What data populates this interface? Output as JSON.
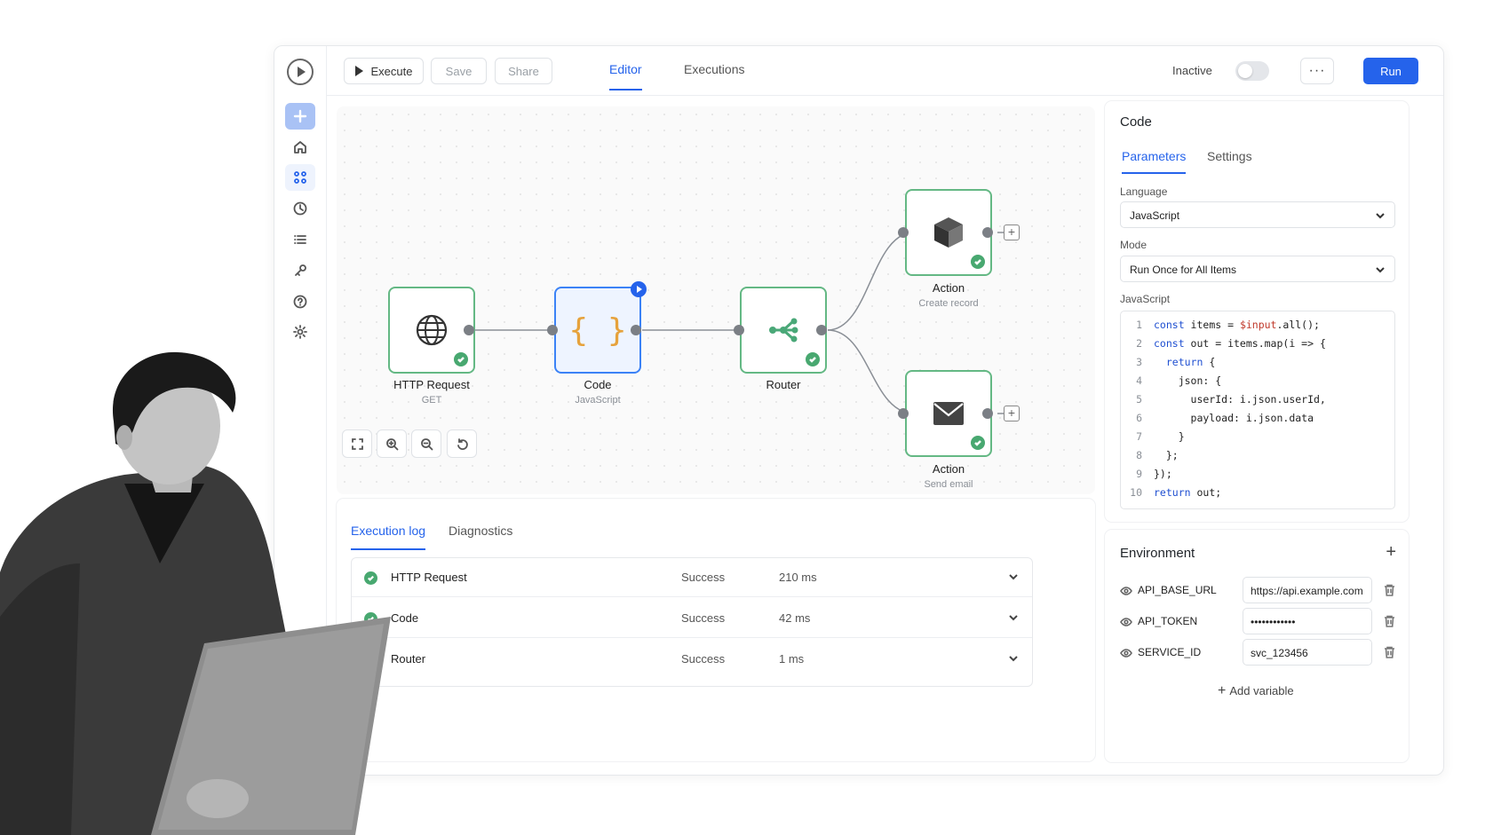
{
  "toolbar": {
    "execute_label": "Execute",
    "save_label": "Save",
    "share_label": "Share",
    "tabs": [
      {
        "label": "Editor",
        "active": true
      },
      {
        "label": "Executions",
        "active": false
      }
    ],
    "inactive_label": "Inactive",
    "more_label": "···",
    "run_label": "Run"
  },
  "sidebar": {
    "icons": [
      "plus-icon",
      "home-icon",
      "workflows-icon",
      "history-icon",
      "list-icon",
      "key-icon",
      "help-icon",
      "settings-icon"
    ]
  },
  "workflow": {
    "nodes": [
      {
        "title": "HTTP Request",
        "subtitle": "GET",
        "status": "success"
      },
      {
        "title": "Code",
        "subtitle": "JavaScript",
        "braces": "{ }",
        "selected": true
      },
      {
        "title": "Router",
        "subtitle": "",
        "status": "success"
      },
      {
        "title": "Action",
        "subtitle": "Create record",
        "status": "success"
      },
      {
        "title": "Action",
        "subtitle": "Send email",
        "status": "success"
      }
    ]
  },
  "log": {
    "tabs": [
      {
        "label": "Execution log",
        "active": true
      },
      {
        "label": "Diagnostics",
        "active": false
      }
    ],
    "rows": [
      {
        "name": "HTTP Request",
        "status": "Success",
        "time": "210 ms"
      },
      {
        "name": "Code",
        "status": "Success",
        "time": "42 ms"
      },
      {
        "name": "Router",
        "status": "Success",
        "time": "1 ms"
      }
    ]
  },
  "panel": {
    "title": "Code",
    "tabs": [
      {
        "label": "Parameters",
        "active": true
      },
      {
        "label": "Settings",
        "active": false
      }
    ],
    "language_label": "Language",
    "language_value": "JavaScript",
    "mode_label": "Mode",
    "mode_value": "Run Once for All Items",
    "code_label": "JavaScript"
  },
  "environment": {
    "title": "Environment",
    "variables": [
      {
        "key": "API_BASE_URL",
        "value": "https://api.example.com"
      },
      {
        "key": "API_TOKEN",
        "value": "••••••••••••"
      },
      {
        "key": "SERVICE_ID",
        "value": "svc_123456"
      }
    ],
    "add_label": "Add variable"
  },
  "colors": {
    "accent": "#2563eb",
    "success": "#48a870",
    "node_border": "#64b884",
    "braces": "#e6a23c"
  }
}
